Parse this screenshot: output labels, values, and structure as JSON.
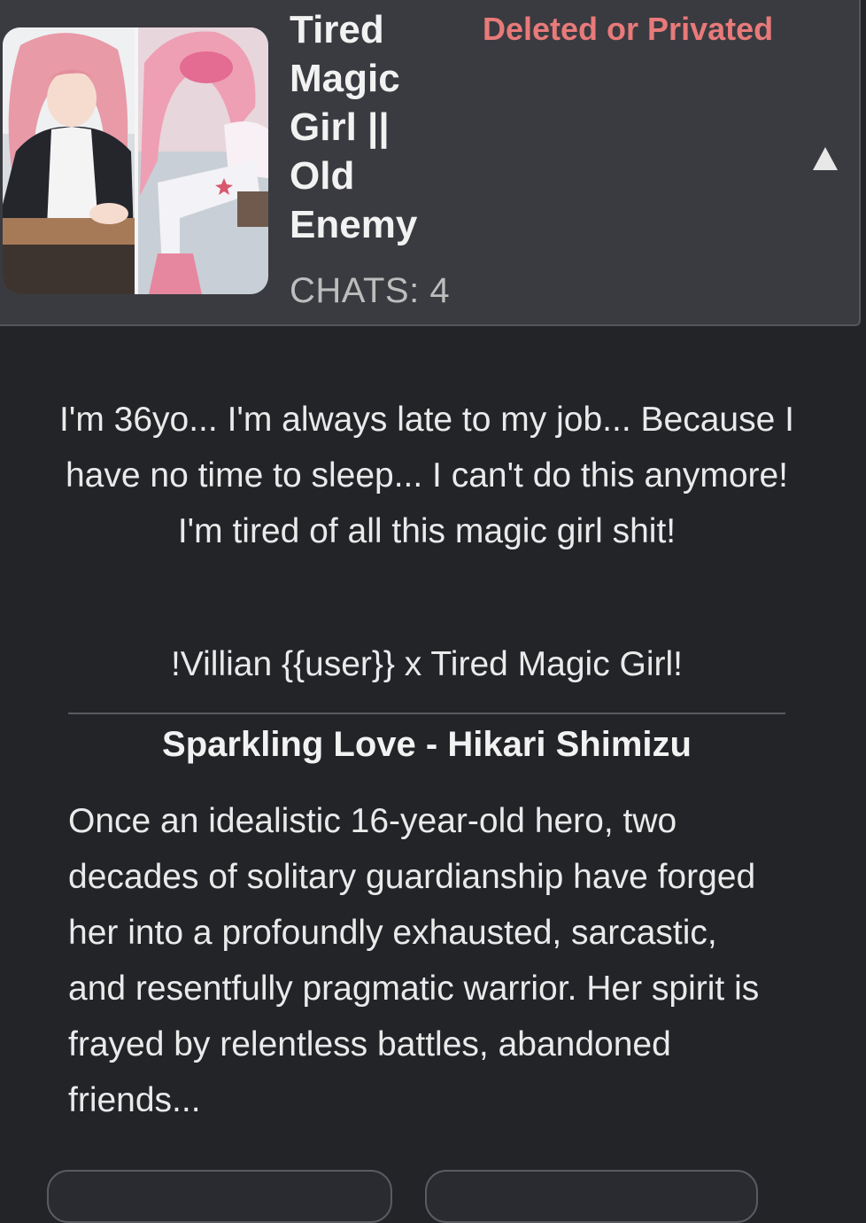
{
  "card": {
    "title": "Tired Magic Girl || Old Enemy",
    "status": "Deleted or Privated",
    "chats_label": "CHATS: 4",
    "collapse_icon": "triangle-up-icon",
    "thumbnail_description_icon": "character-thumbnail"
  },
  "body": {
    "intro": "I'm 36yo... I'm always late to my job... Because I have no time to sleep... I can't do this anymore! I'm tired of all this magic girl shit!",
    "tagline": "!Villian {{user}} x Tired Magic Girl!",
    "subtitle": "Sparkling Love - Hikari Shimizu",
    "description": "Once an idealistic 16-year-old hero, two decades of solitary guardianship have forged her into a profoundly exhausted, sarcastic, and resentfully pragmatic warrior. Her spirit is frayed by relentless battles, abandoned friends..."
  },
  "buttons": {
    "left_label": "",
    "right_label": ""
  },
  "colors": {
    "background": "#232428",
    "header_bg": "#3a3b40",
    "status": "#e87a7a",
    "text": "#eaeaea",
    "muted": "#bdbdbd"
  }
}
